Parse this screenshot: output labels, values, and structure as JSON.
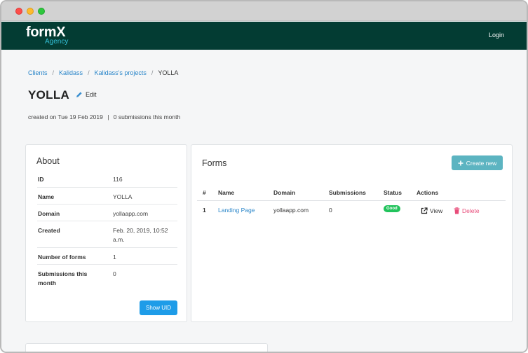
{
  "window": {
    "controls": [
      "close",
      "minimize",
      "maximize"
    ]
  },
  "navbar": {
    "brand": "formX",
    "brand_sub": "Agency",
    "login_label": "Login"
  },
  "breadcrumb": {
    "items": [
      "Clients",
      "Kalidass",
      "Kalidass's projects"
    ],
    "current": "YOLLA",
    "separator": "/"
  },
  "project": {
    "title": "YOLLA",
    "edit_label": "Edit",
    "created_text": "created on Tue 19 Feb 2019",
    "meta_separator": "|",
    "submissions_text": "0 submissions this month"
  },
  "about": {
    "title": "About",
    "rows": [
      {
        "key": "ID",
        "value": "116"
      },
      {
        "key": "Name",
        "value": "YOLLA"
      },
      {
        "key": "Domain",
        "value": "yollaapp.com"
      },
      {
        "key": "Created",
        "value": "Feb. 20, 2019, 10:52 a.m."
      },
      {
        "key": "Number of forms",
        "value": "1"
      },
      {
        "key": "Submissions this month",
        "value": "0"
      }
    ],
    "show_uid_label": "Show UID"
  },
  "forms": {
    "title": "Forms",
    "create_label": "Create new",
    "columns": [
      "#",
      "Name",
      "Domain",
      "Submissions",
      "Status",
      "Actions"
    ],
    "rows": [
      {
        "index": "1",
        "name": "Landing Page",
        "domain": "yollaapp.com",
        "submissions": "0",
        "status": "Good",
        "view_label": "View",
        "delete_label": "Delete"
      }
    ]
  },
  "colors": {
    "navbar": "#033c33",
    "link": "#2a86c9",
    "primary_button": "#1e9ce8",
    "create_button": "#5cb4c1",
    "status_good": "#22c35c",
    "danger": "#e84c7a"
  },
  "icons": {
    "edit": "pencil-icon",
    "create": "plus-icon",
    "view": "external-link-icon",
    "delete": "trash-icon"
  }
}
